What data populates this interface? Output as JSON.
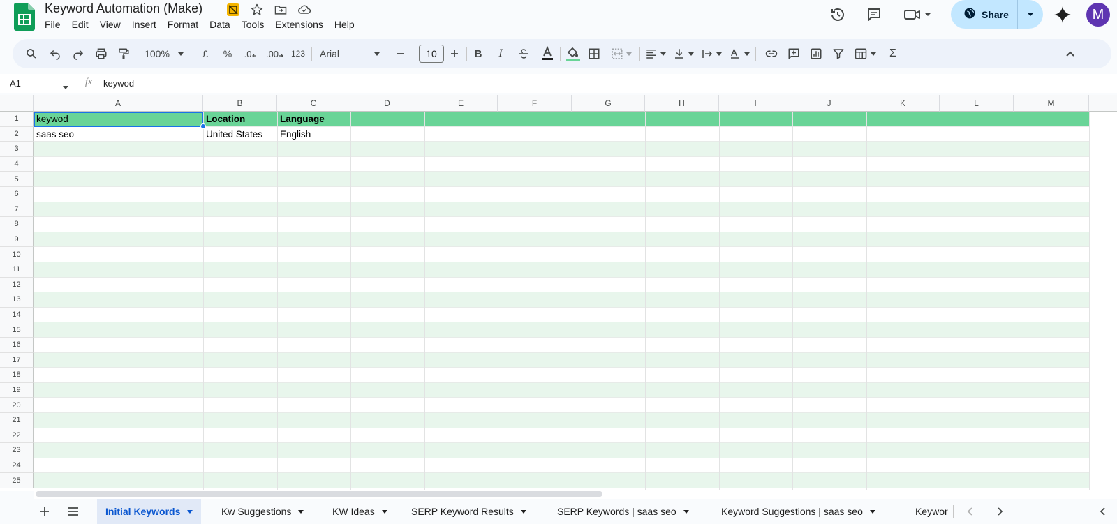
{
  "app": {
    "title": "Keyword Automation (Make)",
    "avatar_letter": "M",
    "share_label": "Share",
    "menu": [
      "File",
      "Edit",
      "View",
      "Insert",
      "Format",
      "Data",
      "Tools",
      "Extensions",
      "Help"
    ]
  },
  "toolbar": {
    "zoom": "100%",
    "currency": "£",
    "percent": "%",
    "dec_less": ".0",
    "dec_more": ".00",
    "number_format": "123",
    "font": "Arial",
    "font_size": "10"
  },
  "formula_bar": {
    "name_box": "A1",
    "fx": "fx",
    "content": "keywod"
  },
  "grid": {
    "columns": [
      "A",
      "B",
      "C",
      "D",
      "E",
      "F",
      "G",
      "H",
      "I",
      "J",
      "K",
      "L",
      "M"
    ],
    "rows": [
      "1",
      "2",
      "3",
      "4",
      "5",
      "6",
      "7",
      "8",
      "9",
      "10",
      "11",
      "12",
      "13",
      "14",
      "15",
      "16",
      "17",
      "18",
      "19",
      "20",
      "21",
      "22",
      "23",
      "24",
      "25"
    ],
    "cells": {
      "a1": "keywod",
      "b1": "Location",
      "c1": "Language",
      "a2": "saas seo",
      "b2": "United States",
      "c2": "English"
    }
  },
  "sheets": {
    "tabs": [
      "Initial Keywords",
      "Kw Suggestions",
      "KW Ideas",
      "SERP Keyword Results",
      "SERP Keywords | saas seo",
      "Keyword Suggestions | saas seo",
      "Keywor"
    ],
    "active": "Initial Keywords"
  },
  "colors": {
    "header_row": "#69d497",
    "band_row": "#e8f6ec",
    "selection": "#1a73e8",
    "share_bg": "#c2e7ff",
    "avatar_bg": "#5e35b1"
  }
}
